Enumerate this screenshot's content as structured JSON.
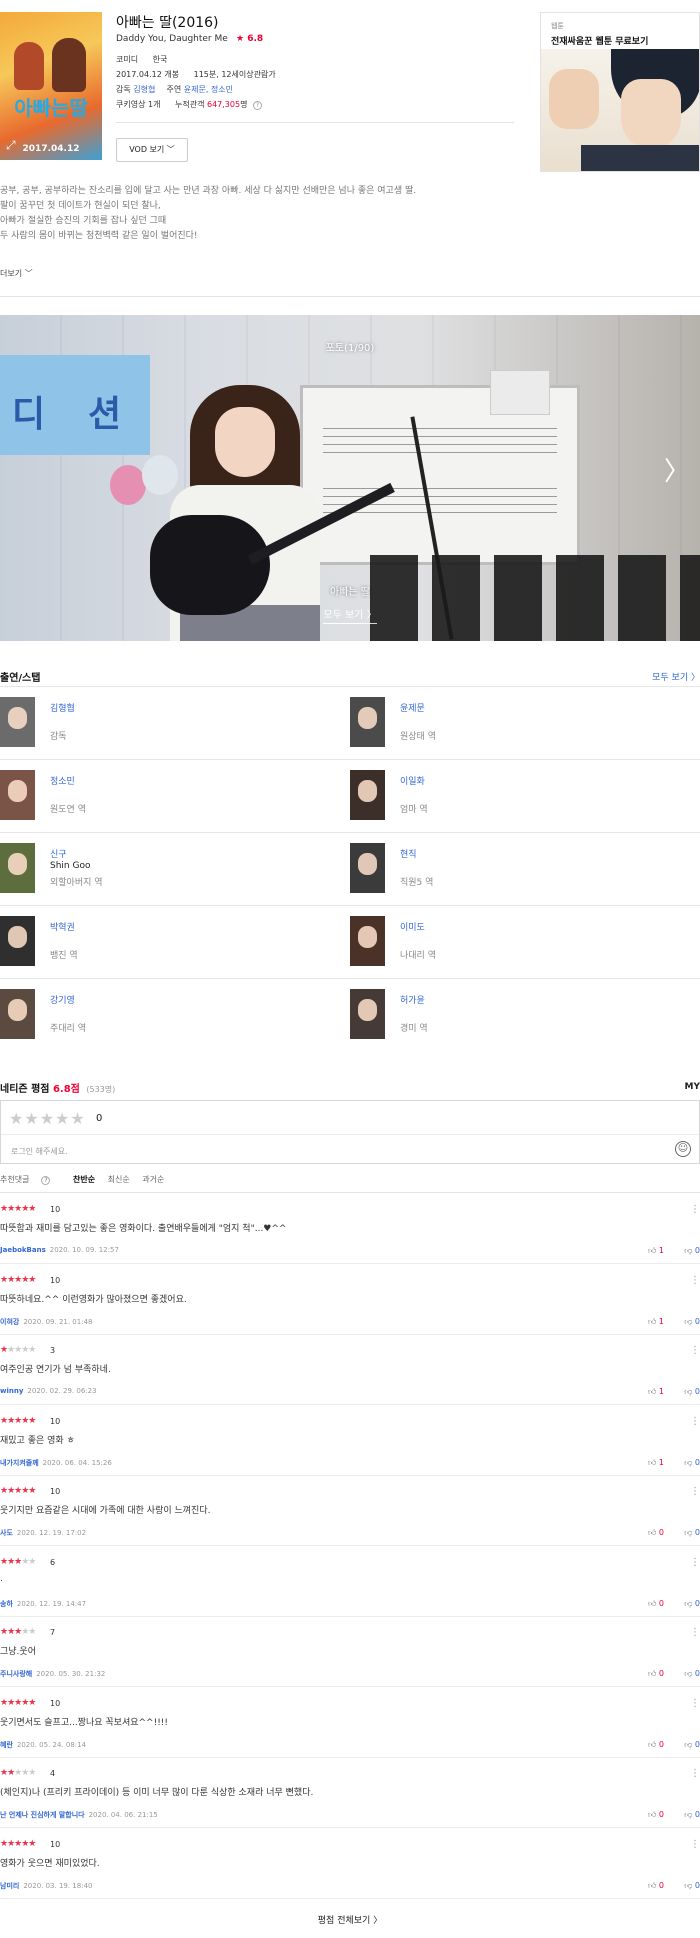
{
  "movie": {
    "title": "아빠는 딸(2016)",
    "rating_star": "★",
    "rating": "6.8",
    "subtitle": "Daddy You, Daughter Me",
    "genre": "코미디",
    "country": "한국",
    "release": "2017.04.12 개봉",
    "runtime_rating": "115분, 12세이상관람가",
    "director_label": "감독",
    "director": "김형협",
    "actors_label": "주연",
    "actors": "윤제문, 정소민",
    "cookie_label": "쿠키영상 1개",
    "audience_label": "누적관객",
    "audience": "647,305",
    "audience_unit": "명",
    "help": "?",
    "vod_button": "VOD 보기",
    "poster_title": "아빠는딸",
    "poster_date": "2017.04.12"
  },
  "ad": {
    "label": "웹툰",
    "headline": "전재싸움꾼 웹툰 무료보기"
  },
  "synopsis": [
    "공부, 공부, 공부하라는 잔소리를 입에 달고 사는 만년 과장 아빠. 세상 다 싫지만 선배만은 넘나 좋은 여고생 딸.",
    "팔이 꿈꾸던 첫 데이트가 현실이 되던 찰나,",
    "아빠가 절실한 승진의 기회를 잡나 싶던 그때",
    "두 사람의 몸이 바뀌는 청천벽력 같은 일이 벌어진다!"
  ],
  "more_label": "더보기",
  "photo": {
    "counter": "포토(1/90)",
    "caption": "아빠는 딸",
    "all_label": "모두 보기",
    "banner_chars": [
      "디",
      "션"
    ]
  },
  "cast_section": {
    "title": "출연/스탭",
    "more": "모두 보기"
  },
  "cast": [
    {
      "name": "김형협",
      "en": "",
      "role": "감독",
      "bg": "#6b6b6b"
    },
    {
      "name": "윤제문",
      "en": "",
      "role": "원상태 역",
      "bg": "#4b4b4b"
    },
    {
      "name": "정소민",
      "en": "",
      "role": "원도연 역",
      "bg": "#7a5446"
    },
    {
      "name": "이일화",
      "en": "",
      "role": "엄마 역",
      "bg": "#3c2f2a"
    },
    {
      "name": "신구",
      "en": "Shin Goo",
      "role": "외할아버지 역",
      "bg": "#5d6d3e"
    },
    {
      "name": "현직",
      "en": "",
      "role": "직원5 역",
      "bg": "#3b3b3b"
    },
    {
      "name": "박혁권",
      "en": "",
      "role": "뱅진 역",
      "bg": "#2f2f2f"
    },
    {
      "name": "이미도",
      "en": "",
      "role": "나대리 역",
      "bg": "#4a3228"
    },
    {
      "name": "강기영",
      "en": "",
      "role": "주대리 역",
      "bg": "#5a4a40"
    },
    {
      "name": "허가윤",
      "en": "",
      "role": "경미 역",
      "bg": "#463a36"
    }
  ],
  "reviews_section": {
    "title": "네티즌 평점",
    "score": "6.8점",
    "count": "(533명)",
    "my": "MY",
    "empty_stars": "★★★★★",
    "zero": "0",
    "placeholder": "로그인 해주세요.",
    "sort_labels": [
      "추천댓글",
      "찬반순",
      "최신순",
      "과거순"
    ],
    "sort_help": "?",
    "all_reviews": "평점 전체보기"
  },
  "reviews": [
    {
      "filled": "★★★★★",
      "empty": "",
      "score": "10",
      "text": "따뜻함과 재미를 담고있는 좋은 영화이다. 출연배우들에게 \"엄지 척\"...♥^^",
      "user": "JaebokBans",
      "date": "2020. 10. 09. 12:57",
      "up": "1",
      "down": "0"
    },
    {
      "filled": "★★★★★",
      "empty": "",
      "score": "10",
      "text": "따뜻하네요.^^ 이런영화가 많아졌으면 좋겠어요.",
      "user": "이혀강",
      "date": "2020. 09. 21. 01:48",
      "up": "1",
      "down": "0"
    },
    {
      "filled": "★",
      "empty": "★★★★",
      "score": "3",
      "text": "여주인공 연기가 넘 부족하네.",
      "user": "winny",
      "date": "2020. 02. 29. 06:23",
      "up": "1",
      "down": "0"
    },
    {
      "filled": "★★★★★",
      "empty": "",
      "score": "10",
      "text": "재밌고  좋은  영화 ㅎ",
      "user": "내가지켜줄께",
      "date": "2020. 06. 04. 15:26",
      "up": "1",
      "down": "0"
    },
    {
      "filled": "★★★★★",
      "empty": "",
      "score": "10",
      "text": "웃기지만 요즘같은 시대에 가족에 대한 사랑이 느껴진다.",
      "user": "사도",
      "date": "2020. 12. 19. 17:02",
      "up": "0",
      "down": "0"
    },
    {
      "filled": "★★★",
      "empty": "★★",
      "score": "6",
      "text": ".",
      "user": "송하",
      "date": "2020. 12. 19. 14:47",
      "up": "0",
      "down": "0"
    },
    {
      "filled": "★★★",
      "empty": "★★",
      "score": "7",
      "text": "그냥.웃어",
      "user": "주니사랑해",
      "date": "2020. 05. 30. 21:32",
      "up": "0",
      "down": "0"
    },
    {
      "filled": "★★★★★",
      "empty": "",
      "score": "10",
      "text": "웃기면서도 슬프고...짱나요 꼭보셔요^^!!!!",
      "user": "혜란",
      "date": "2020. 05. 24. 08:14",
      "up": "0",
      "down": "0"
    },
    {
      "filled": "★★",
      "empty": "★★★",
      "score": "4",
      "text": "(체인지)나 (프리키 프라이데이) 등 이미 너무 많이 다룬 식상한 소재라 너무 뻔했다.",
      "user": "난 언제나 진심하게 말합니다",
      "date": "2020. 04. 06. 21:15",
      "up": "0",
      "down": "0"
    },
    {
      "filled": "★★★★★",
      "empty": "",
      "score": "10",
      "text": "영화가 웃으면 재미있었다.",
      "user": "남미리",
      "date": "2020. 03. 19. 18:40",
      "up": "0",
      "down": "0"
    }
  ],
  "icons": {
    "thumb_up": "thumb-up-icon",
    "thumb_down": "thumb-down-icon",
    "more": "more-vertical-icon",
    "next": "chevron-right-icon",
    "chevron_down": "chevron-down-icon",
    "emoji": "smile-icon",
    "expand": "expand-icon"
  },
  "colors": {
    "accent_red": "#e03",
    "link_blue": "#3367d6",
    "star_red": "#f0304a"
  }
}
